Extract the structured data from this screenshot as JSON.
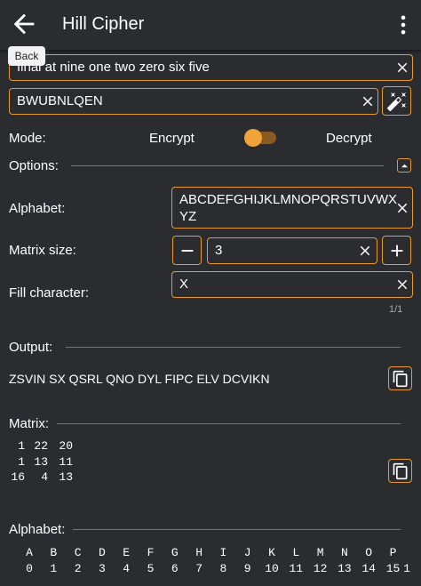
{
  "app": {
    "title": "Hill Cipher",
    "tooltip": "Back"
  },
  "input": {
    "value": "final at nine one two zero six five"
  },
  "key": {
    "value": "BWUBNLQEN"
  },
  "mode": {
    "label": "Mode:",
    "left": "Encrypt",
    "right": "Decrypt",
    "selected": "Encrypt"
  },
  "options": {
    "label": "Options:",
    "alphabet_label": "Alphabet:",
    "alphabet_line1": "ABCDEFGHIJKLMNOPQRSTUVWX",
    "alphabet_line2": "YZ",
    "matrix_size_label": "Matrix size:",
    "matrix_size_value": "3",
    "fill_label": "Fill character:",
    "fill_value": "X",
    "fill_counter": "1/1"
  },
  "output": {
    "label": "Output:",
    "value": "ZSVIN SX QSRL QNO DYL FIPC ELV DCVIKN"
  },
  "matrix": {
    "label": "Matrix:",
    "rows": [
      [
        "1",
        "22",
        "20"
      ],
      [
        "1",
        "13",
        "11"
      ],
      [
        "16",
        "4",
        "13"
      ]
    ]
  },
  "alphabet_table": {
    "label": "Alphabet:",
    "letters": [
      "A",
      "B",
      "C",
      "D",
      "E",
      "F",
      "G",
      "H",
      "I",
      "J",
      "K",
      "L",
      "M",
      "N",
      "O",
      "P"
    ],
    "indices": [
      "0",
      "1",
      "2",
      "3",
      "4",
      "5",
      "6",
      "7",
      "8",
      "9",
      "10",
      "11",
      "12",
      "13",
      "14",
      "15"
    ],
    "trailing_digit": "1"
  },
  "colors": {
    "accent": "#e89a2f",
    "background": "#2b2c30"
  }
}
